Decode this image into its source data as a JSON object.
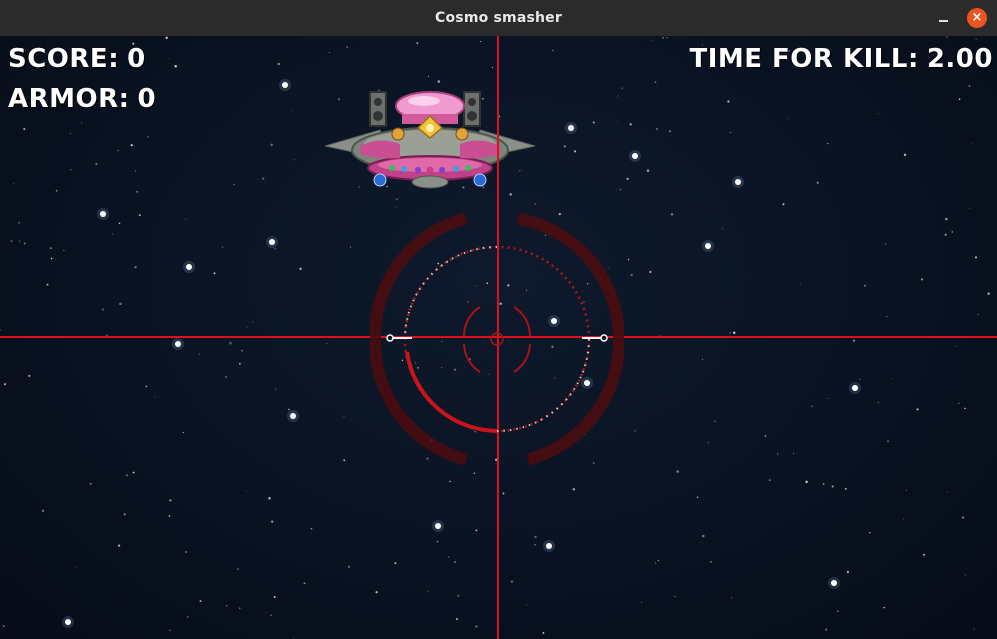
{
  "window": {
    "title": "Cosmo smasher",
    "minimize_glyph": "−",
    "close_glyph": "×",
    "accent_color": "#e9541f"
  },
  "hud": {
    "score": {
      "label": "SCORE:",
      "value": "0"
    },
    "armor": {
      "label": "ARMOR:",
      "value": "0"
    },
    "timer": {
      "label": "TIME FOR KILL:",
      "value": "2.00"
    }
  },
  "scene": {
    "background": "starfield",
    "enemy": "alien-mothership",
    "crosshair_color": "#e0101a",
    "reticle_color": "#b0141a"
  }
}
